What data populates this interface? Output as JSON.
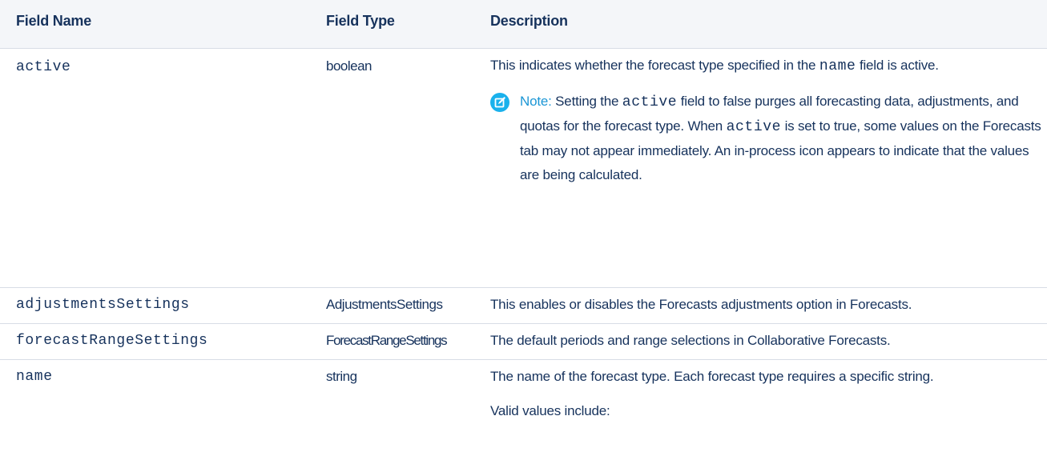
{
  "table": {
    "headers": {
      "field_name": "Field Name",
      "field_type": "Field Type",
      "description": "Description"
    },
    "rows": {
      "active": {
        "name": "active",
        "type": "boolean",
        "desc_before_code": "This indicates whether the forecast type specified in the",
        "desc_code": "name",
        "desc_after_code": "field is active.",
        "note_label": "Note:",
        "note_part1": "Setting the",
        "note_code1": "active",
        "note_part2": "field to false purges all forecasting data, adjustments, and quotas for the forecast type. When",
        "note_code2": "active",
        "note_part3": "is set to true, some values on the Forecasts tab may not appear immediately. An in-process icon appears to indicate that the values are being calculated."
      },
      "adjustments": {
        "name": "adjustmentsSettings",
        "type": "AdjustmentsSettings",
        "desc": "This enables or disables the Forecasts adjustments option in Forecasts."
      },
      "range": {
        "name": "forecastRangeSettings",
        "type": "ForecastRangeSettings",
        "desc": "The default periods and range selections in Collaborative Forecasts."
      },
      "name_row": {
        "name": "name",
        "type": "string",
        "desc": "The name of the forecast type. Each forecast type requires a specific string.",
        "valid": "Valid values include:"
      }
    }
  },
  "note_icon": "edit-note-icon",
  "colors": {
    "header_bg": "#f4f6f9",
    "text": "#16325c",
    "note_blue": "#1ab1ec",
    "divider": "#d8dde6"
  }
}
